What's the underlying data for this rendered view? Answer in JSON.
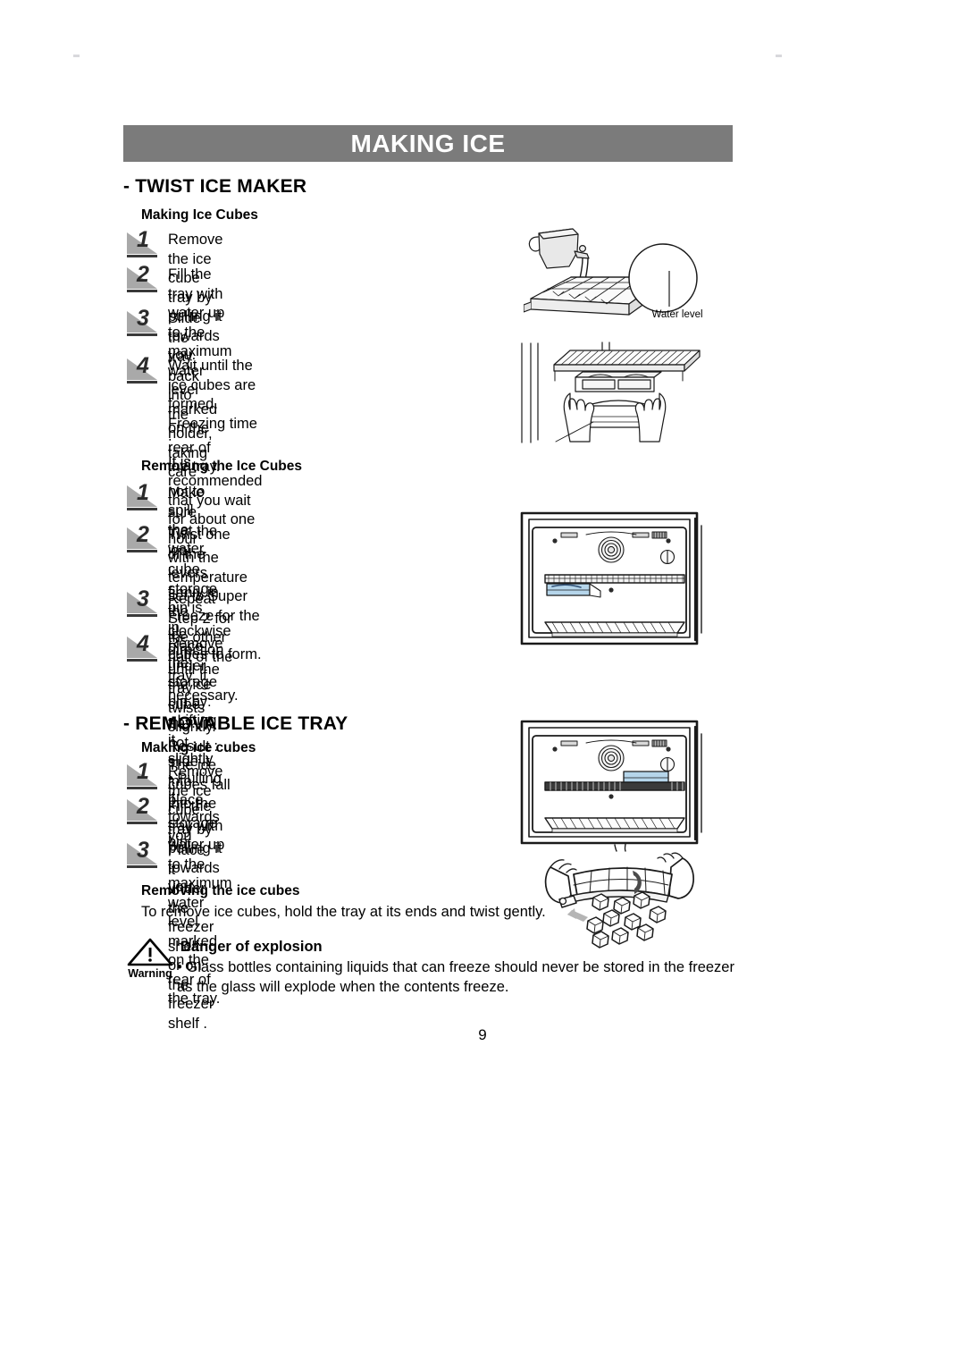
{
  "document": {
    "chapter_title": "MAKING ICE",
    "page_number": "9"
  },
  "sections": [
    {
      "id": "twist-ice-maker",
      "title": "- TWIST ICE MAKER",
      "subsections": [
        {
          "id": "making-ice-cubes",
          "heading": "Making Ice Cubes",
          "steps": [
            {
              "number": "1",
              "text": "Remove the ice cube tray by pulling it towards you."
            },
            {
              "number": "2",
              "text": "Fill the tray with water up to the maximum water level\nmarked on the rear of the tray."
            },
            {
              "number": "3",
              "text": "Slide the tray back into the holder, taking care not to\nspill the water."
            },
            {
              "number": "4",
              "text": "Wait until the ice cubes are formed.\nFreezing time :\nIt is recommended that you wait for about one hour\nwith the temperature set to Super Freeze for the ice\ncubes to form."
            }
          ]
        },
        {
          "id": "removing-the-ice-cubes",
          "heading": "Removing the Ice Cubes",
          "steps": [
            {
              "number": "1",
              "text": "Make sure that the ice cube storage bin is in place\nunder the ice cube tray. If not, slide it into place."
            },
            {
              "number": "2",
              "text": "Twist one of the levers firmly in the clockwise direction\nuntil the tray twists slightly.\nResult : The ice cubes fall into the storage bin."
            },
            {
              "number": "3",
              "text": "Repeat Step 2 for the other half of the tray, if\nnecessary."
            },
            {
              "number": "4",
              "text": "Remove the storage bin by:\n• Lifting it slightly\n• Pulling it towards you"
            }
          ]
        }
      ]
    },
    {
      "id": "removable-ice-tray",
      "title": "- REMOVABLE ICE TRAY",
      "subsections": [
        {
          "id": "making-ice-cubes-2",
          "heading": "Making ice cubes",
          "steps": [
            {
              "number": "1",
              "text": "Remove the ice cube tray by pulling it towards you."
            },
            {
              "number": "2",
              "text": "Fill the tray with water up to the maximum water level\nmarked on the rear of the tray."
            },
            {
              "number": "3",
              "text": "Place it under the freezer shelf or on the freezer shelf ."
            }
          ]
        },
        {
          "id": "removing-the-ice-cubes-2",
          "heading": "Removing the ice cubes",
          "paragraph": "To remove ice cubes, hold the tray at its ends and twist gently."
        }
      ]
    }
  ],
  "warning": {
    "icon_label": "Warning",
    "title": "Danger of explosion",
    "text": "• Glass bottles containing liquids that can freeze should never be stored in the freezer\n  as the glass will explode when the contents freeze."
  },
  "illustrations": {
    "pour_tray": {
      "caption": "Water level"
    },
    "tray_in_holder": {
      "caption": ""
    },
    "freezer_bin_low": {
      "caption": ""
    },
    "freezer_tray_shelf": {
      "caption": ""
    },
    "twist_tray": {
      "caption": ""
    }
  },
  "colors": {
    "header_bar": "#7b7b7b",
    "header_text": "#ffffff",
    "body_text": "#000000",
    "step_shadow": "#a9a9a9",
    "tray_blue": "#b5d5ea",
    "line_art": "#1a1a1a"
  }
}
